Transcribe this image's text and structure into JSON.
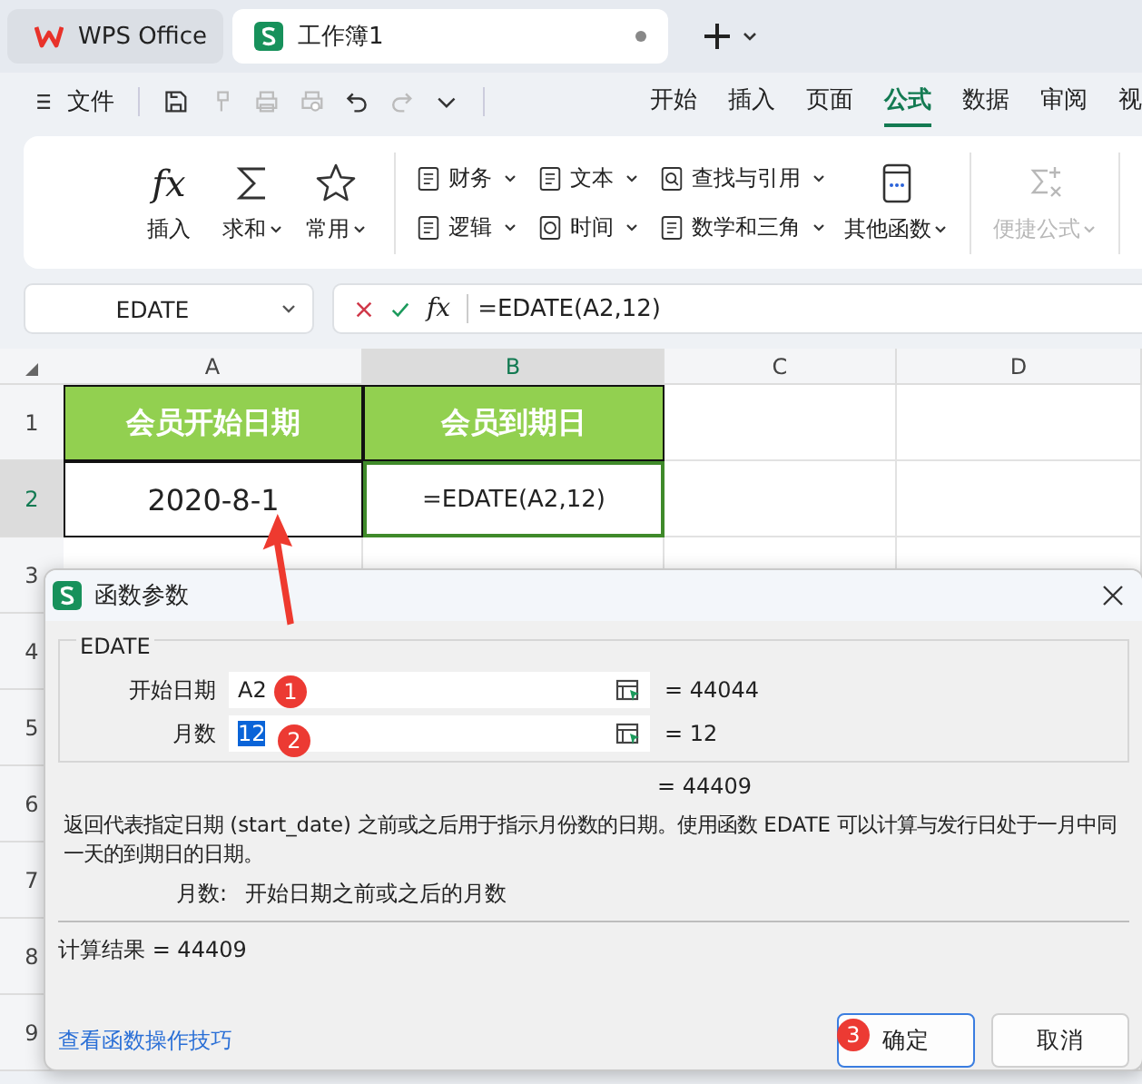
{
  "app_tabs": [
    {
      "label": "WPS Office",
      "kind": "home",
      "selected": false
    },
    {
      "label": "工作簿1",
      "kind": "sheet",
      "selected": true
    }
  ],
  "menu": {
    "file": "文件"
  },
  "ribbon_tabs": [
    {
      "label": "开始",
      "selected": false
    },
    {
      "label": "插入",
      "selected": false
    },
    {
      "label": "页面",
      "selected": false
    },
    {
      "label": "公式",
      "selected": true
    },
    {
      "label": "数据",
      "selected": false
    },
    {
      "label": "审阅",
      "selected": false
    },
    {
      "label": "视",
      "selected": false
    }
  ],
  "ribbon": {
    "large_buttons": [
      {
        "label": "插入",
        "icon_text": "fx",
        "dropdown": false
      },
      {
        "label": "求和",
        "dropdown": true
      },
      {
        "label": "常用",
        "dropdown": true
      }
    ],
    "small_buttons": [
      {
        "label": "财务"
      },
      {
        "label": "逻辑"
      },
      {
        "label": "文本"
      },
      {
        "label": "时间"
      },
      {
        "label": "查找与引用"
      },
      {
        "label": "数学和三角"
      }
    ],
    "more_button": {
      "label": "其他函数"
    },
    "quick_button": {
      "label": "便捷公式",
      "disabled": true
    }
  },
  "formula_bar": {
    "name_box": "EDATE",
    "fx": "fx",
    "formula": "=EDATE(A2,12)"
  },
  "columns": [
    {
      "label": "A",
      "selected": false
    },
    {
      "label": "B",
      "selected": true
    },
    {
      "label": "C",
      "selected": false
    },
    {
      "label": "D",
      "selected": false
    }
  ],
  "rows": [
    {
      "label": "1",
      "selected": false,
      "kind": "header",
      "cells": [
        "会员开始日期",
        "会员到期日"
      ]
    },
    {
      "label": "2",
      "selected": true,
      "kind": "data",
      "cells": [
        "2020-8-1",
        "=EDATE(A2,12)"
      ]
    },
    {
      "label": "3",
      "selected": false
    },
    {
      "label": "4",
      "selected": false
    },
    {
      "label": "5",
      "selected": false
    },
    {
      "label": "6",
      "selected": false
    },
    {
      "label": "7",
      "selected": false
    },
    {
      "label": "8",
      "selected": false
    },
    {
      "label": "9",
      "selected": false
    }
  ],
  "dialog": {
    "title": "函数参数",
    "function": "EDATE",
    "args": [
      {
        "label": "开始日期",
        "value": "A2",
        "value_selected": false,
        "result": "=  44044"
      },
      {
        "label": "月数",
        "value": "12",
        "value_selected": true,
        "result": "=  12"
      }
    ],
    "result": "=  44409",
    "description": "返回代表指定日期 (start_date) 之前或之后用于指示月份数的日期。使用函数 EDATE 可以计算与发行日处于一月中同一天的到期日的日期。",
    "arg_help_label": "月数:",
    "arg_help": "开始日期之前或之后的月数",
    "calc_result": "计算结果  =  44409",
    "link": "查看函数操作技巧",
    "buttons": [
      {
        "label": "确定",
        "kind": "primary"
      },
      {
        "label": "取消",
        "kind": "secondary"
      }
    ]
  },
  "annotations": [
    {
      "label": "1"
    },
    {
      "label": "2"
    },
    {
      "label": "3"
    }
  ]
}
